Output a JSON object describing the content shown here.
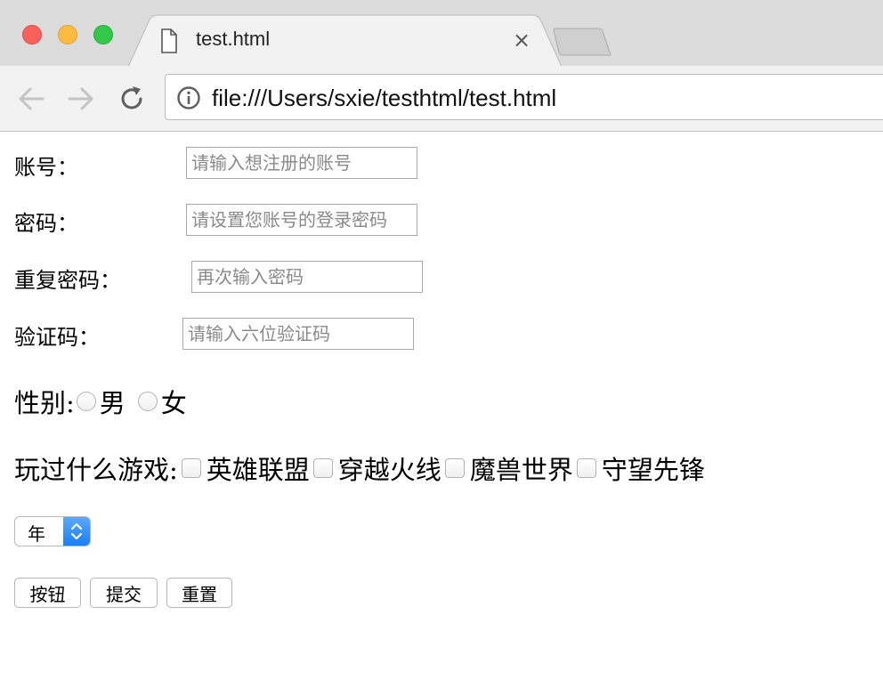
{
  "browser": {
    "tab_title": "test.html",
    "close_glyph": "×",
    "url": "file:///Users/sxie/testhtml/test.html",
    "icons": {
      "tab": "document-icon",
      "back": "arrow-left-icon",
      "forward": "arrow-right-icon",
      "reload": "reload-icon",
      "info": "info-icon"
    }
  },
  "form": {
    "account": {
      "label": "账号：",
      "placeholder": "请输入想注册的账号"
    },
    "password": {
      "label": "密码：",
      "placeholder": "请设置您账号的登录密码"
    },
    "repeat_password": {
      "label": "重复密码：",
      "placeholder": "再次输入密码"
    },
    "captcha": {
      "label": "验证码：",
      "placeholder": "请输入六位验证码"
    },
    "gender": {
      "label": "性别:",
      "options": [
        "男",
        "女"
      ]
    },
    "games": {
      "label": "玩过什么游戏:",
      "options": [
        "英雄联盟",
        "穿越火线",
        "魔兽世界",
        "守望先锋"
      ]
    },
    "year_select": {
      "value": "年"
    },
    "buttons": {
      "button": "按钮",
      "submit": "提交",
      "reset": "重置"
    }
  },
  "colors": {
    "traffic_red": "#fc605c",
    "traffic_yellow": "#fdbc40",
    "traffic_green": "#34c84a",
    "select_accent": "#1a7ff5"
  }
}
